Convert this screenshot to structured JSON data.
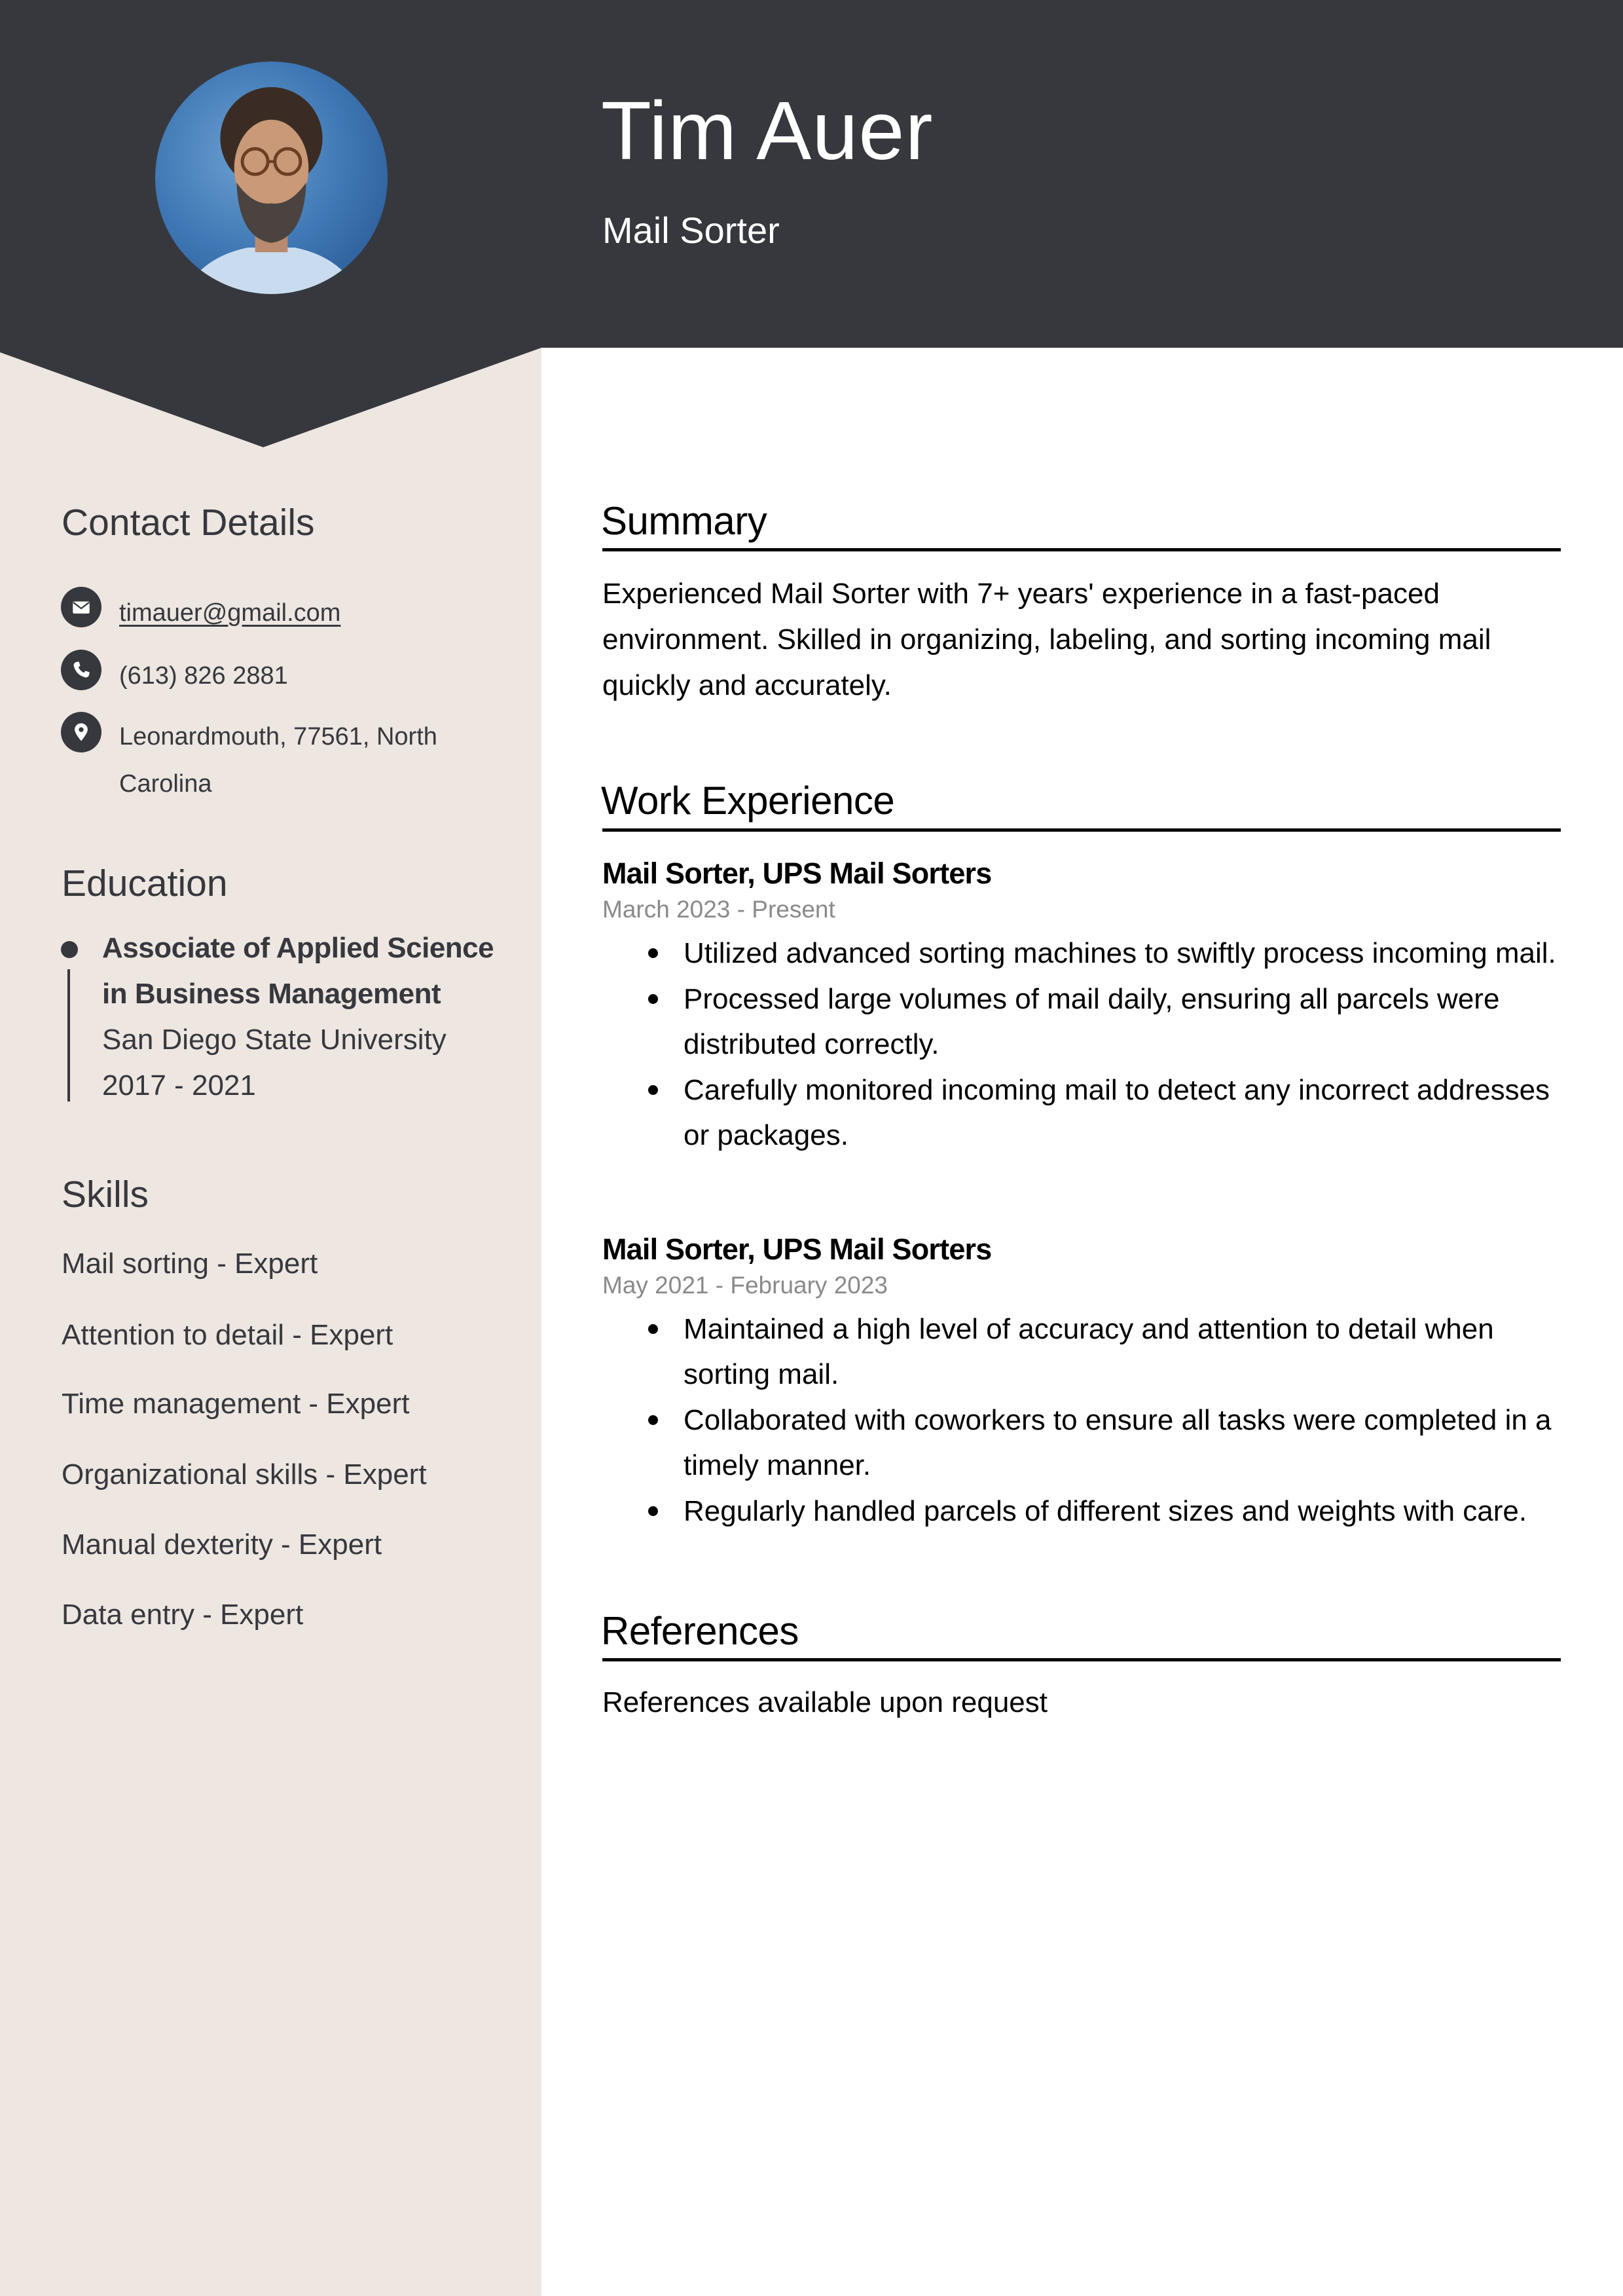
{
  "header": {
    "name": "Tim Auer",
    "title": "Mail Sorter",
    "photo_alt": "profile-photo"
  },
  "colors": {
    "header_bg": "#37383e",
    "sidebar_bg": "#ede6e1",
    "text_dark": "#37383e",
    "date_grey": "#8a8a8a"
  },
  "sidebar": {
    "contact": {
      "heading": "Contact Details",
      "items": [
        {
          "icon": "envelope-icon",
          "text": "timauer@gmail.com"
        },
        {
          "icon": "phone-icon",
          "text": "(613) 826 2881"
        },
        {
          "icon": "location-pin-icon",
          "text": "Leonardmouth, 77561, North Carolina"
        }
      ]
    },
    "education": {
      "heading": "Education",
      "items": [
        {
          "degree": "Associate of Applied Science in Business Management",
          "school": "San Diego State University",
          "years": "2017 - 2021"
        }
      ]
    },
    "skills": {
      "heading": "Skills",
      "items": [
        "Mail sorting - Expert",
        "Attention to detail - Expert",
        "Time management - Expert",
        "Organizational skills - Expert",
        "Manual dexterity - Expert",
        "Data entry - Expert"
      ]
    }
  },
  "main": {
    "summary": {
      "heading": "Summary",
      "text": "Experienced Mail Sorter with 7+ years' experience in a fast-paced environment. Skilled in organizing, labeling, and sorting incoming mail quickly and accurately."
    },
    "experience": {
      "heading": "Work Experience",
      "jobs": [
        {
          "title": "Mail Sorter, UPS Mail Sorters",
          "dates": "March 2023 - Present",
          "bullets": [
            "Utilized advanced sorting machines to swiftly process incoming mail.",
            "Processed large volumes of mail daily, ensuring all parcels were distributed correctly.",
            "Carefully monitored incoming mail to detect any incorrect addresses or packages."
          ]
        },
        {
          "title": "Mail Sorter, UPS Mail Sorters",
          "dates": "May 2021 - February 2023",
          "bullets": [
            "Maintained a high level of accuracy and attention to detail when sorting mail.",
            "Collaborated with coworkers to ensure all tasks were completed in a timely manner.",
            "Regularly handled parcels of different sizes and weights with care."
          ]
        }
      ]
    },
    "references": {
      "heading": "References",
      "text": "References available upon request"
    }
  }
}
